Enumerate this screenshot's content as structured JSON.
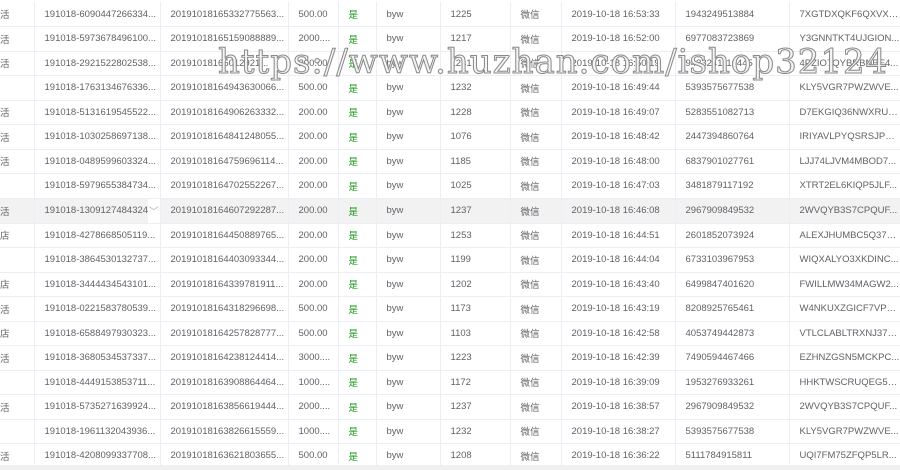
{
  "rows": [
    {
      "c0": "活",
      "order": "191018-6090447266334...",
      "trade": "20191018165332775563...",
      "amount": "500.00",
      "paid": "是",
      "user": "byw",
      "uid": "1225",
      "channel": "微信",
      "time": "2019-10-18 16:53:33",
      "phone": "1943249513884",
      "code": "7XGTDXQKF6QXVX6..."
    },
    {
      "c0": "活",
      "order": "191018-5973678496100...",
      "trade": "20191018165159088889...",
      "amount": "2000....",
      "paid": "是",
      "user": "byw",
      "uid": "1217",
      "channel": "微信",
      "time": "2019-10-18 16:52:00",
      "phone": "6977083723869",
      "code": "Y3GNNTKT4UJGION..."
    },
    {
      "c0": "活",
      "order": "191018-2921522802538...",
      "trade": "20191018165012921...",
      "amount": "200.00",
      "paid": "是",
      "user": "byw",
      "uid": "1241",
      "channel": "微信",
      "time": "2019-10-18 16:50:19",
      "phone": "9433241116445",
      "code": "4PZIO7QYBRBNBE4..."
    },
    {
      "c0": "",
      "order": "191018-1763134676336...",
      "trade": "20191018164943630066...",
      "amount": "500.00",
      "paid": "是",
      "user": "byw",
      "uid": "1232",
      "channel": "微信",
      "time": "2019-10-18 16:49:44",
      "phone": "5393575677538",
      "code": "KLY5VGR7PWZWVE..."
    },
    {
      "c0": "活",
      "order": "191018-5131619545522...",
      "trade": "20191018164906263332...",
      "amount": "200.00",
      "paid": "是",
      "user": "byw",
      "uid": "1228",
      "channel": "微信",
      "time": "2019-10-18 16:49:07",
      "phone": "5283551082713",
      "code": "D7EKGIQ36NWXRUQ..."
    },
    {
      "c0": "活",
      "order": "191018-1030258697138...",
      "trade": "20191018164841248055...",
      "amount": "200.00",
      "paid": "是",
      "user": "byw",
      "uid": "1076",
      "channel": "微信",
      "time": "2019-10-18 16:48:42",
      "phone": "2447394860764",
      "code": "IRIYAVLPYQSRSJPQ..."
    },
    {
      "c0": "活",
      "order": "191018-0489599603324...",
      "trade": "20191018164759696114...",
      "amount": "200.00",
      "paid": "是",
      "user": "byw",
      "uid": "1185",
      "channel": "微信",
      "time": "2019-10-18 16:48:00",
      "phone": "6837901027761",
      "code": "LJJ74LJVM4MBOD7..."
    },
    {
      "c0": "",
      "order": "191018-5979655384734...",
      "trade": "20191018164702552267...",
      "amount": "200.00",
      "paid": "是",
      "user": "byw",
      "uid": "1025",
      "channel": "微信",
      "time": "2019-10-18 16:47:03",
      "phone": "3481879117192",
      "code": "XTRT2EL6KIQP5JLF..."
    },
    {
      "c0": "活",
      "order": "191018-1309127484324",
      "trade": "20191018164607292287...",
      "amount": "200.00",
      "paid": "是",
      "user": "byw",
      "uid": "1237",
      "channel": "微信",
      "time": "2019-10-18 16:46:08",
      "phone": "2967909849532",
      "code": "2WVQYB3S7CPQUF...",
      "highlight": true
    },
    {
      "c0": "店",
      "order": "191018-4278668505119...",
      "trade": "20191018164450889765...",
      "amount": "200.00",
      "paid": "是",
      "user": "byw",
      "uid": "1253",
      "channel": "微信",
      "time": "2019-10-18 16:44:51",
      "phone": "2601852073924",
      "code": "ALEXJHUMBC5Q37E..."
    },
    {
      "c0": "",
      "order": "191018-3864530132737...",
      "trade": "20191018164403093344...",
      "amount": "200.00",
      "paid": "是",
      "user": "byw",
      "uid": "1199",
      "channel": "微信",
      "time": "2019-10-18 16:44:04",
      "phone": "6733103967953",
      "code": "WIQXALYO3XKDINC..."
    },
    {
      "c0": "店",
      "order": "191018-3444434543101...",
      "trade": "20191018164339781911...",
      "amount": "200.00",
      "paid": "是",
      "user": "byw",
      "uid": "1202",
      "channel": "微信",
      "time": "2019-10-18 16:43:40",
      "phone": "6499847401620",
      "code": "FWILLMW34MAGW2..."
    },
    {
      "c0": "活",
      "order": "191018-0221583780539...",
      "trade": "20191018164318296698...",
      "amount": "500.00",
      "paid": "是",
      "user": "byw",
      "uid": "1173",
      "channel": "微信",
      "time": "2019-10-18 16:43:19",
      "phone": "8208925765461",
      "code": "W4NKUXZGICF7VPO..."
    },
    {
      "c0": "店",
      "order": "191018-6588497930323...",
      "trade": "20191018164257828777...",
      "amount": "500.00",
      "paid": "是",
      "user": "byw",
      "uid": "1103",
      "channel": "微信",
      "time": "2019-10-18 16:42:58",
      "phone": "4053749442873",
      "code": "VTLCLABLTRXNJ374..."
    },
    {
      "c0": "活",
      "order": "191018-3680534537337...",
      "trade": "20191018164238124414...",
      "amount": "3000....",
      "paid": "是",
      "user": "byw",
      "uid": "1223",
      "channel": "微信",
      "time": "2019-10-18 16:42:39",
      "phone": "7490594467466",
      "code": "EZHNZGSN5MCKPC..."
    },
    {
      "c0": "",
      "order": "191018-4449153853711...",
      "trade": "20191018163908864464...",
      "amount": "1000....",
      "paid": "是",
      "user": "byw",
      "uid": "1172",
      "channel": "微信",
      "time": "2019-10-18 16:39:09",
      "phone": "1953276933261",
      "code": "HHKTWSCRUQEG5S..."
    },
    {
      "c0": "活",
      "order": "191018-5735271639924...",
      "trade": "20191018163856619444...",
      "amount": "2000....",
      "paid": "是",
      "user": "byw",
      "uid": "1237",
      "channel": "微信",
      "time": "2019-10-18 16:38:57",
      "phone": "2967909849532",
      "code": "2WVQYB3S7CPQUF..."
    },
    {
      "c0": "",
      "order": "191018-1961132043936...",
      "trade": "20191018163826615559...",
      "amount": "1000....",
      "paid": "是",
      "user": "byw",
      "uid": "1232",
      "channel": "微信",
      "time": "2019-10-18 16:38:27",
      "phone": "5393575677538",
      "code": "KLY5VGR7PWZWVE..."
    },
    {
      "c0": "活",
      "order": "191018-4208099337708...",
      "trade": "20191018163621803655...",
      "amount": "500.00",
      "paid": "是",
      "user": "byw",
      "uid": "1208",
      "channel": "微信",
      "time": "2019-10-18 16:36:22",
      "phone": "5111784915811",
      "code": "UQI7FM75ZFQP5LR..."
    }
  ],
  "watermark": "https://www.huzhan.com/ishop32124",
  "colors": {
    "paid_yes": "#1a9a1a",
    "row_highlight": "#f2f2f2"
  }
}
